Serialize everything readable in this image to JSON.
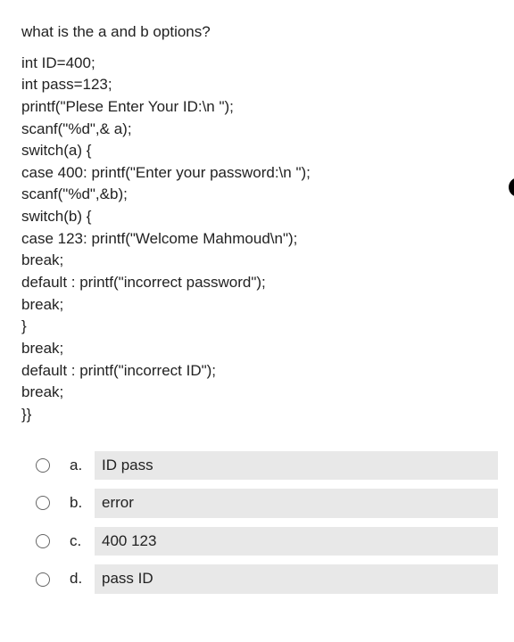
{
  "question": {
    "title": "what is the a and b options?"
  },
  "code": {
    "lines": [
      "int ID=400;",
      "int pass=123;",
      "printf(\"Plese Enter Your ID:\\n \");",
      "scanf(\"%d\",& a);",
      "switch(a) {",
      "case 400: printf(\"Enter your password:\\n \");",
      "scanf(\"%d\",&b);",
      "switch(b) {",
      "case 123: printf(\"Welcome Mahmoud\\n\");",
      "break;",
      "default : printf(\"incorrect password\");",
      "break;",
      "}",
      "break;",
      "default : printf(\"incorrect ID\");",
      "break;",
      "}}"
    ]
  },
  "options": [
    {
      "letter": "a.",
      "text": "ID pass"
    },
    {
      "letter": "b.",
      "text": "error"
    },
    {
      "letter": "c.",
      "text": "400 123"
    },
    {
      "letter": "d.",
      "text": "pass ID"
    }
  ]
}
